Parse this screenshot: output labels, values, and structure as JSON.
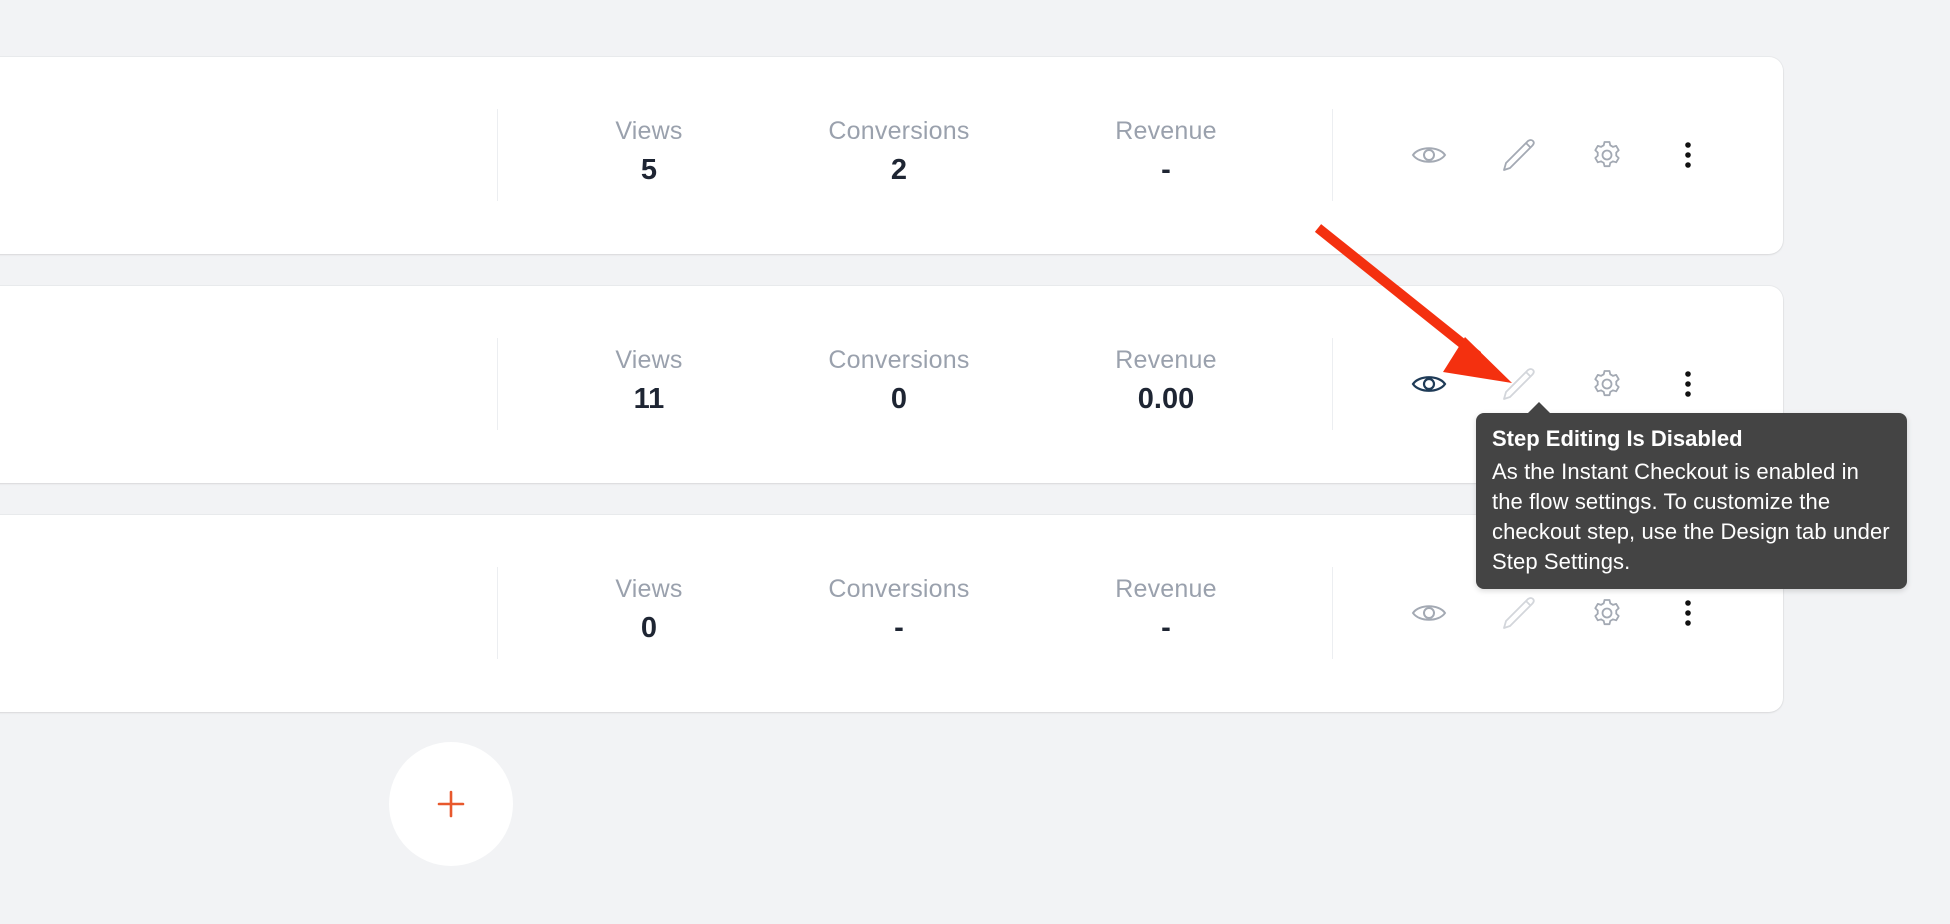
{
  "steps": [
    {
      "metrics": {
        "views_label": "Views",
        "views": "5",
        "conversions_label": "Conversions",
        "conversions": "2",
        "revenue_label": "Revenue",
        "revenue": "-"
      },
      "actions": {
        "preview": "eye-icon",
        "edit": "pencil-icon",
        "settings": "gear-icon",
        "more": "kebab-menu-icon"
      },
      "edit_disabled": false,
      "preview_active": false
    },
    {
      "metrics": {
        "views_label": "Views",
        "views": "11",
        "conversions_label": "Conversions",
        "conversions": "0",
        "revenue_label": "Revenue",
        "revenue": "0.00"
      },
      "actions": {
        "preview": "eye-icon",
        "edit": "pencil-icon",
        "settings": "gear-icon",
        "more": "kebab-menu-icon"
      },
      "edit_disabled": true,
      "preview_active": true
    },
    {
      "metrics": {
        "views_label": "Views",
        "views": "0",
        "conversions_label": "Conversions",
        "conversions": "-",
        "revenue_label": "Revenue",
        "revenue": "-"
      },
      "actions": {
        "preview": "eye-icon",
        "edit": "pencil-icon",
        "settings": "gear-icon",
        "more": "kebab-menu-icon"
      },
      "edit_disabled": true,
      "preview_active": false
    }
  ],
  "tooltip": {
    "title": "Step Editing Is Disabled",
    "body": "As the Instant Checkout is enabled in the flow settings. To customize the checkout step, use the Design tab under Step Settings."
  },
  "add_step": {
    "icon": "plus-icon"
  },
  "colors": {
    "background": "#f2f3f5",
    "card": "#ffffff",
    "metric_label": "#9aa1ad",
    "metric_value": "#1e2533",
    "icon_muted": "#a3a9b3",
    "icon_disabled": "#d3d6db",
    "icon_active": "#1f3b57",
    "accent": "#e8582c",
    "tooltip_bg": "#444444",
    "annotation_arrow": "#f4300f"
  }
}
